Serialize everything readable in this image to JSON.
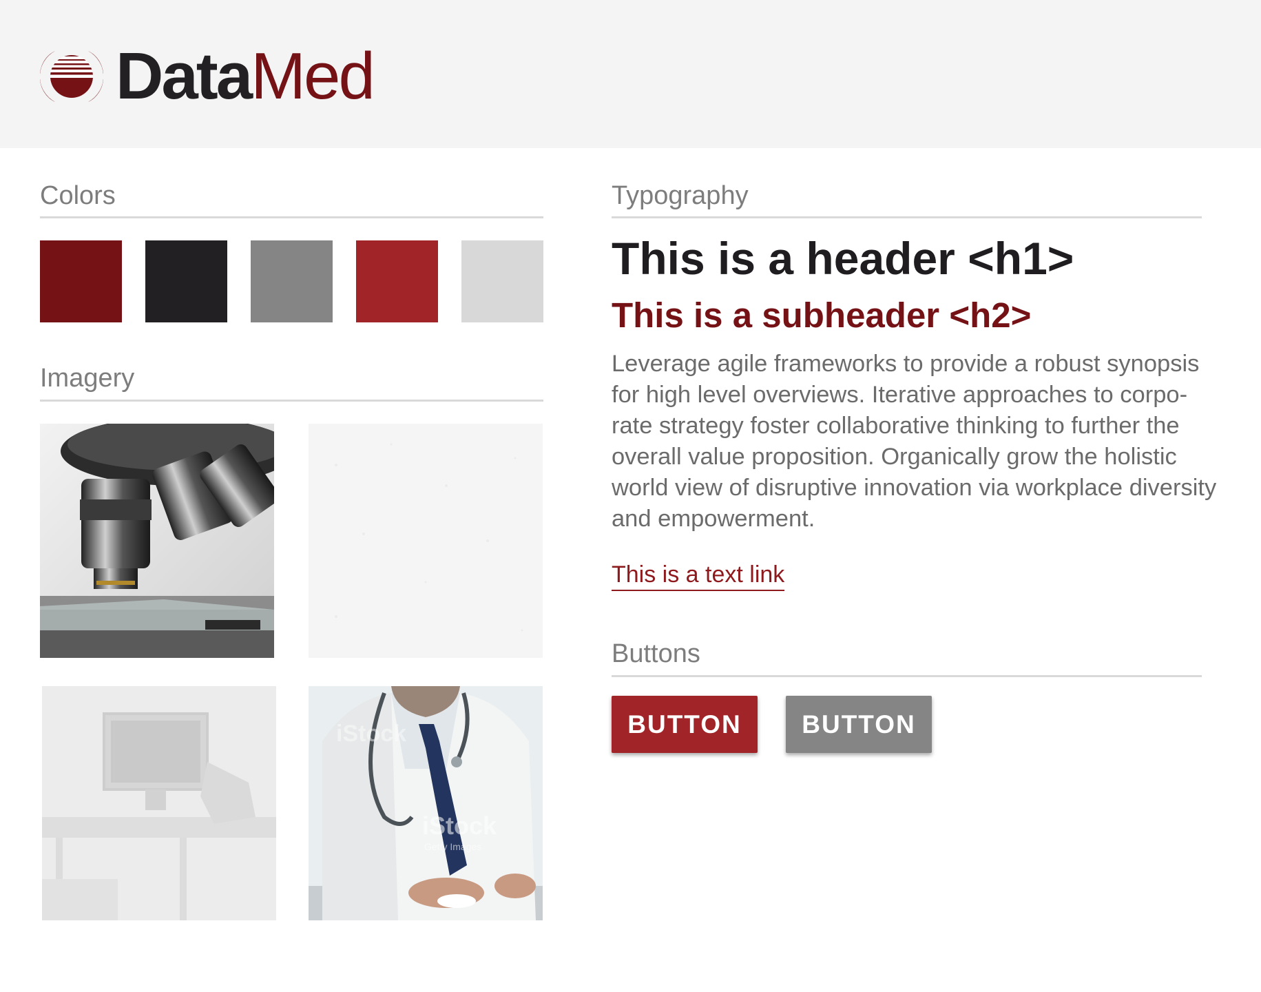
{
  "brand": {
    "name_part1": "Data",
    "name_part2": "Med"
  },
  "colors_section": {
    "title": "Colors",
    "swatches": [
      "#751216",
      "#222022",
      "#858585",
      "#a12428",
      "#d8d8d8"
    ]
  },
  "imagery_section": {
    "title": "Imagery",
    "images": [
      "microscope-photo",
      "paper-texture",
      "lab-background-photo",
      "doctor-photo"
    ],
    "watermark": "iStock",
    "watermark_sub": "Getty Images"
  },
  "typography_section": {
    "title": "Typography",
    "h1": "This is a header <h1>",
    "h2": "This is a subheader <h2>",
    "body": "Leverage agile frameworks to provide a robust synopsis for high level overviews. Iterative approaches to corpo-rate strategy foster collaborative thinking to further the overall value proposition. Organically grow the holistic world view of disruptive innovation via workplace diversity and empowerment.",
    "link": "This is a text link"
  },
  "buttons_section": {
    "title": "Buttons",
    "primary_label": "BUTTON",
    "secondary_label": "BUTTON"
  }
}
